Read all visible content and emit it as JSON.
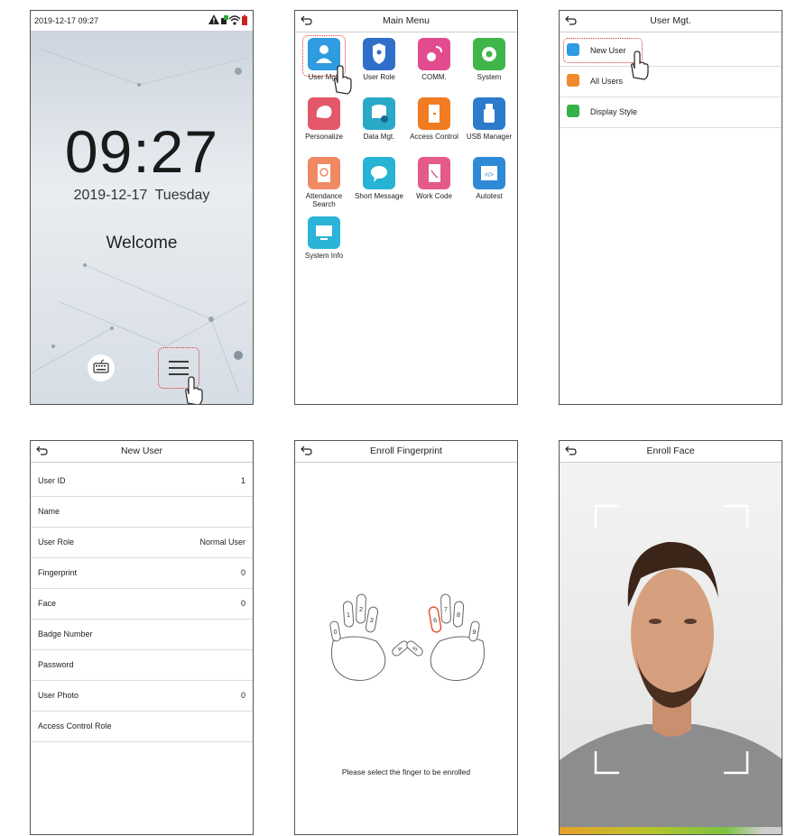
{
  "screen1": {
    "status_datetime": "2019-12-17  09:27",
    "clock": "09:27",
    "date": "2019-12-17",
    "weekday": "Tuesday",
    "welcome": "Welcome",
    "icons": [
      "warning-icon",
      "network-icon",
      "wifi-icon",
      "battery-icon",
      "keyboard-icon",
      "menu-icon",
      "pointer-hand-icon"
    ]
  },
  "main_menu": {
    "title": "Main Menu",
    "items": [
      {
        "label": "User Mgt.",
        "color": "#2f9be0"
      },
      {
        "label": "User Role",
        "color": "#2f6fc9"
      },
      {
        "label": "COMM.",
        "color": "#e24c8f"
      },
      {
        "label": "System",
        "color": "#3fb54a"
      },
      {
        "label": "Personalize",
        "color": "#e4576a"
      },
      {
        "label": "Data Mgt.",
        "color": "#2aa8c8"
      },
      {
        "label": "Access Control",
        "color": "#f07b20"
      },
      {
        "label": "USB Manager",
        "color": "#2c7bcc"
      },
      {
        "label": "Attendance Search",
        "color": "#ef8a64"
      },
      {
        "label": "Short Message",
        "color": "#27b3d4"
      },
      {
        "label": "Work Code",
        "color": "#e45a8a"
      },
      {
        "label": "Autotest",
        "color": "#2e8ad6"
      },
      {
        "label": "System Info",
        "color": "#2bb3d8"
      }
    ]
  },
  "user_mgt": {
    "title": "User Mgt.",
    "items": [
      {
        "label": "New User",
        "color": "#2f9be0"
      },
      {
        "label": "All Users",
        "color": "#f08a2a"
      },
      {
        "label": "Display Style",
        "color": "#35b24a"
      }
    ]
  },
  "new_user": {
    "title": "New User",
    "fields": [
      {
        "label": "User ID",
        "value": "1"
      },
      {
        "label": "Name",
        "value": ""
      },
      {
        "label": "User Role",
        "value": "Normal User"
      },
      {
        "label": "Fingerprint",
        "value": "0"
      },
      {
        "label": "Face",
        "value": "0"
      },
      {
        "label": "Badge Number",
        "value": ""
      },
      {
        "label": "Password",
        "value": ""
      },
      {
        "label": "User Photo",
        "value": "0"
      },
      {
        "label": "Access Control Role",
        "value": ""
      }
    ]
  },
  "enroll_fp": {
    "title": "Enroll Fingerprint",
    "fingers": [
      "0",
      "1",
      "2",
      "3",
      "4",
      "5",
      "6",
      "7",
      "8",
      "9"
    ],
    "selected_finger": "6",
    "hint": "Please select the finger to be enrolled"
  },
  "enroll_face": {
    "title": "Enroll Face",
    "progress_colors": [
      "#e8a02a",
      "#b8c42b",
      "#7cc243"
    ]
  }
}
